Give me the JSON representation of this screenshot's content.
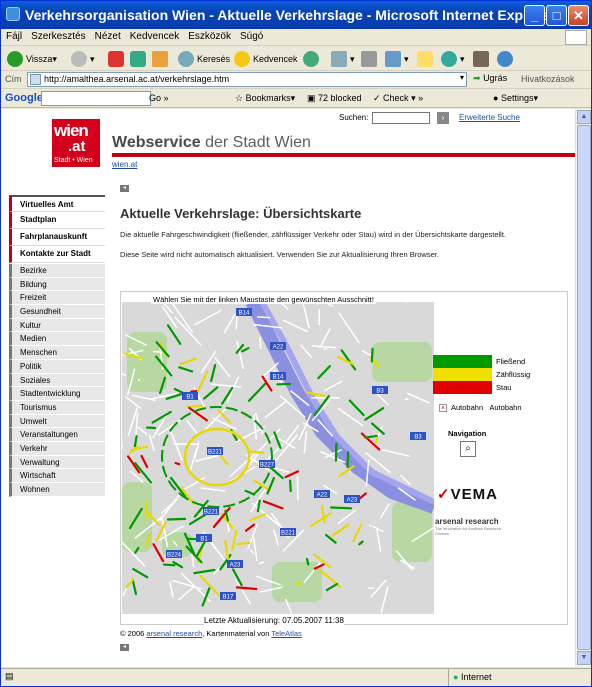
{
  "window": {
    "title": "Verkehrsorganisation Wien - Aktuelle Verkehrslage - Microsoft Internet Explorer"
  },
  "menu": [
    "Fájl",
    "Szerkesztés",
    "Nézet",
    "Kedvencek",
    "Eszközök",
    "Súgó"
  ],
  "toolbar": {
    "back": "Vissza",
    "search": "Keresés",
    "favorites": "Kedvencek"
  },
  "address": {
    "label": "Cím",
    "url": "http://amalthea.arsenal.ac.at/verkehrslage.htm",
    "go": "Ugrás",
    "links": "Hivatkozások"
  },
  "googlebar": {
    "logo": "Google",
    "go": "Go",
    "bookmarks": "Bookmarks▾",
    "blocked": "72 blocked",
    "check": "Check",
    "settings": "Settings▾"
  },
  "site": {
    "logo_top": "wien",
    "logo_at": ".at",
    "logo_sub": "Stadt • Wien",
    "brand_bold": "Webservice",
    "brand_rest": " der Stadt Wien",
    "wien_link": "wien.at",
    "search_label": "Suchen:",
    "extended_search": "Erweiterte Suche"
  },
  "nav_main": [
    "Virtuelles Amt",
    "Stadtplan",
    "Fahrplanauskunft",
    "Kontakte zur Stadt"
  ],
  "nav_sub": [
    "Bezirke",
    "Bildung",
    "Freizeit",
    "Gesundheit",
    "Kultur",
    "Medien",
    "Menschen",
    "Politik",
    "Soziales",
    "Stadtentwicklung",
    "Tourismus",
    "Umwelt",
    "Veranstaltungen",
    "Verkehr",
    "Verwaltung",
    "Wirtschaft",
    "Wohnen"
  ],
  "content": {
    "heading": "Aktuelle Verkehrslage: Übersichtskarte",
    "para1": "Die aktuelle Fahrgeschwindigkeit (fließender, zähflüssiger Verkehr oder Stau) wird in der Übersichtskarte dargestellt.",
    "para2": "Diese Seite wird nicht automatisch aktualisiert. Verwenden Sie zur Aktualisierung Ihren Browser.",
    "map_caption": "Wählen Sie mit der linken Maustaste den gewünschten Ausschnitt!",
    "legend": [
      {
        "label": "Fließend",
        "color": "#009900"
      },
      {
        "label": "Zähflüssig",
        "color": "#f0e000"
      },
      {
        "label": "Stau",
        "color": "#e00000"
      }
    ],
    "autobahn_icon": "Autobahn",
    "autobahn_label": "Autobahn",
    "navigation_label": "Navigation",
    "vema": "VEMA",
    "arsenal_name": "arsenal research",
    "arsenal_sub": "The Innovation for Austrian Research Centers",
    "last_update": "Letzte Aktualisierung: 07.05.2007 11:38",
    "copyright_prefix": "© 2006 ",
    "copyright_link1": "arsenal research",
    "copyright_mid": ", Kartenmaterial von ",
    "copyright_link2": "TeleAtlas",
    "road_labels": [
      "B14",
      "A22",
      "B14",
      "B3",
      "B3",
      "A23",
      "A22",
      "B221",
      "B227",
      "B221",
      "B1",
      "B224",
      "A23",
      "B1",
      "B221",
      "B17"
    ]
  },
  "status": {
    "left": "",
    "zone": "Internet"
  }
}
